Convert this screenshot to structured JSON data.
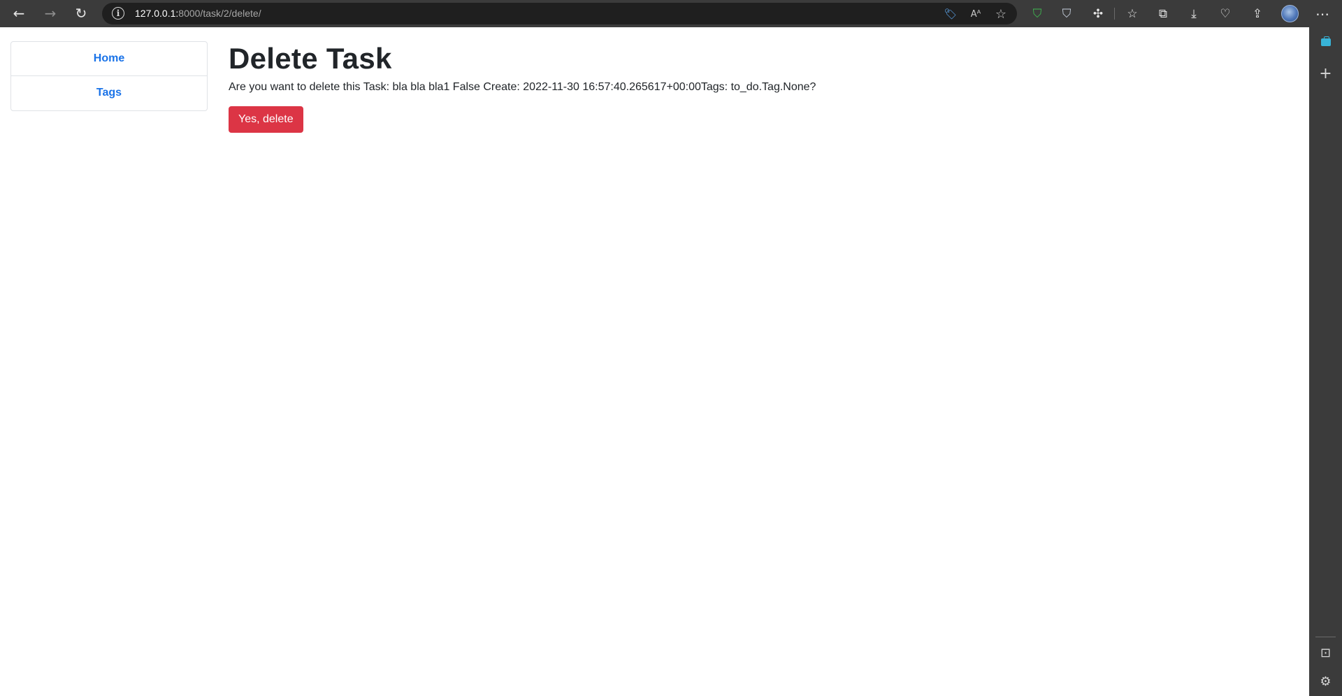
{
  "browser": {
    "url_host": "127.0.0.1:",
    "url_path": "8000/task/2/delete/",
    "icons": {
      "back": "←",
      "forward": "→",
      "refresh": "↻",
      "site_info": "i",
      "price_tag": "🏷",
      "read_aloud": "Aᴬ",
      "add_favorite": "☆",
      "shield_green": "⛉",
      "shield_gray": "⛉",
      "extensions": "✣",
      "favorites": "☆",
      "collections": "⧉",
      "downloads": "⤓",
      "performance": "♡",
      "share": "⇪",
      "more": "⋯",
      "panel_add": "+",
      "panel_layout": "⊡",
      "panel_settings": "⚙"
    },
    "colors": {
      "toolbar": "#3b3b3b",
      "address_bar": "#1f1f1f",
      "shield_green": "#3fb950",
      "price_tag": "#5ea8f0"
    }
  },
  "nav": {
    "items": [
      {
        "label": "Home"
      },
      {
        "label": "Tags"
      }
    ]
  },
  "main": {
    "title": "Delete Task",
    "message": "Are you want to delete this Task: bla bla bla1 False Create: 2022-11-30 16:57:40.265617+00:00Tags: to_do.Tag.None?",
    "confirm_label": "Yes, delete"
  },
  "colors": {
    "link": "#1a73e8",
    "danger": "#dc3545",
    "text": "#212529"
  }
}
